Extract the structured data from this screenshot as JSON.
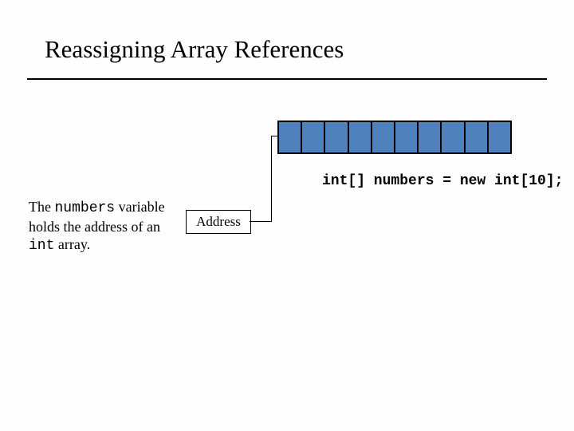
{
  "title": "Reassigning Array References",
  "code_line": "int[] numbers = new int[10];",
  "address_label": "Address",
  "caption_pre": "The ",
  "caption_var": "numbers",
  "caption_mid": " variable holds the address of an ",
  "caption_type": "int",
  "caption_post": " array.",
  "array_cells": 10
}
